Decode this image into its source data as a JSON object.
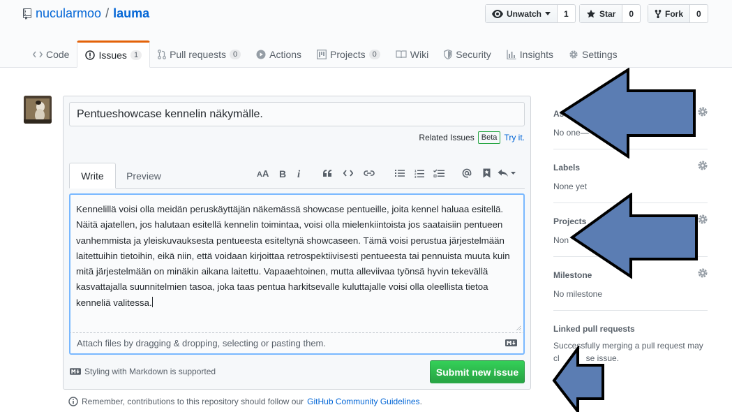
{
  "repo": {
    "owner": "nucularmoo",
    "separator": "/",
    "name": "lauma"
  },
  "actions": {
    "watch": {
      "label": "Unwatch",
      "count": "1"
    },
    "star": {
      "label": "Star",
      "count": "0"
    },
    "fork": {
      "label": "Fork",
      "count": "0"
    }
  },
  "tabs": [
    {
      "label": "Code"
    },
    {
      "label": "Issues",
      "count": "1"
    },
    {
      "label": "Pull requests",
      "count": "0"
    },
    {
      "label": "Actions"
    },
    {
      "label": "Projects",
      "count": "0"
    },
    {
      "label": "Wiki"
    },
    {
      "label": "Security"
    },
    {
      "label": "Insights"
    },
    {
      "label": "Settings"
    }
  ],
  "issue": {
    "title": "Pentueshowcase kennelin näkymälle.",
    "related_label": "Related Issues",
    "beta_label": "Beta",
    "try_label": "Try it.",
    "write_tab": "Write",
    "preview_tab": "Preview",
    "body": "Kennelillä voisi olla meidän peruskäyttäjän näkemässä showcase pentueille, joita kennel haluaa esitellä. Näitä ajatellen, jos halutaan esitellä kennelin toimintaa, voisi olla mielenkiintoista jos saataisiin pentueen vanhemmista ja yleiskuvauksesta pentueesta esiteltynä showcaseen. Tämä voisi perustua järjestelmään laitettuihin tietoihin, eikä niin, että voidaan kirjoittaa retrospektiivisesti pentueesta tai pennuista muuta kuin mitä järjestelmään on minäkin aikana laitettu. Vapaaehtoinen, mutta alleviivaa työnsä hyvin tekevällä kasvattajalla suunnitelmien tasoa, joka taas pentua harkitsevalle kuluttajalle voisi olla oleellista tietoa kenneliä valitessa.",
    "attach_hint": "Attach files by dragging & dropping, selecting or pasting them.",
    "markdown_hint": "Styling with Markdown is supported",
    "submit_label": "Submit new issue",
    "guidelines_prefix": "Remember, contributions to this repository should follow our",
    "guidelines_link": "GitHub Community Guidelines",
    "guidelines_suffix": "."
  },
  "sidebar": {
    "assignees": {
      "title": "As",
      "value": "No one—"
    },
    "labels": {
      "title": "Labels",
      "value": "None yet"
    },
    "projects": {
      "title": "Projects",
      "value": "Non"
    },
    "milestone": {
      "title": "Milestone",
      "value": "No milestone"
    },
    "linked": {
      "title": "Linked pull requests",
      "value_line1": "Successfully merging a pull request may",
      "value_line2": "cl",
      "value_line2_tail": "se issue."
    }
  },
  "colors": {
    "accent": "#0366d6",
    "submit_green": "#2cbe4e",
    "selected_tab_border": "#e36209",
    "arrow_fill": "#5b7db3",
    "arrow_stroke": "#000000"
  }
}
